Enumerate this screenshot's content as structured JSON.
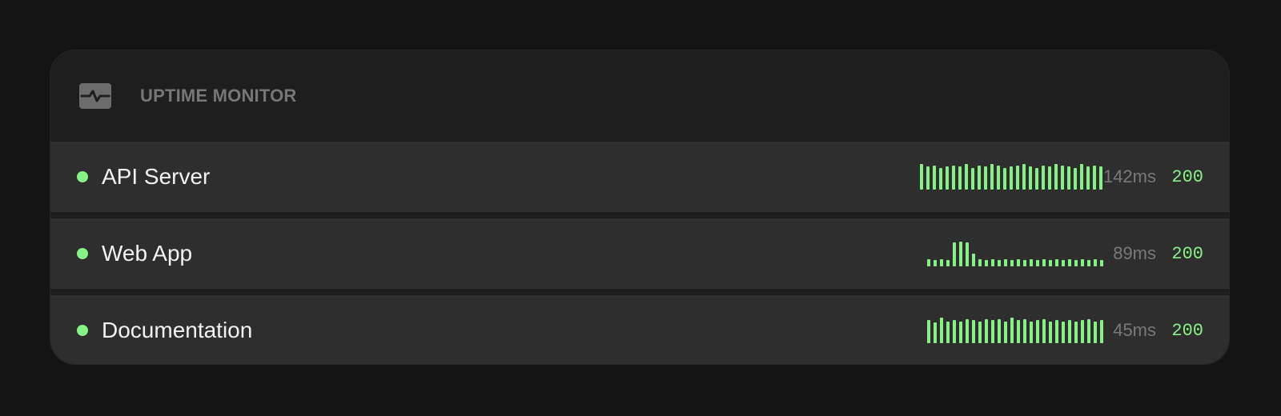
{
  "header": {
    "title": "UPTIME MONITOR",
    "icon": "activity-pulse-icon"
  },
  "colors": {
    "up": "#86f286",
    "degraded": "#f08484",
    "latency_text": "#7a7a7a"
  },
  "services": [
    {
      "name": "API Server",
      "status": "up",
      "latency": "142ms",
      "code": "200",
      "history": {
        "levels": [
          1,
          0.9,
          0.95,
          0.85,
          0.9,
          0.95,
          0.9,
          1,
          0.85,
          0.95,
          0.9,
          1,
          0.95,
          0.85,
          0.9,
          0.95,
          1,
          0.9,
          0.85,
          0.95,
          0.9,
          1,
          0.95,
          0.9,
          0.85,
          1,
          0.9,
          0.95,
          0.9
        ],
        "states": [
          "up",
          "up",
          "up",
          "up",
          "up",
          "up",
          "up",
          "up",
          "up",
          "up",
          "up",
          "up",
          "up",
          "up",
          "up",
          "up",
          "up",
          "up",
          "up",
          "up",
          "up",
          "up",
          "up",
          "up",
          "up",
          "up",
          "up",
          "up",
          "up"
        ]
      }
    },
    {
      "name": "Web App",
      "status": "up",
      "latency": "89ms",
      "code": "200",
      "history": {
        "levels": [
          0.28,
          0.25,
          0.28,
          0.25,
          0.95,
          0.98,
          0.95,
          0.5,
          0.28,
          0.25,
          0.28,
          0.25,
          0.28,
          0.25,
          0.28,
          0.25,
          0.28,
          0.25,
          0.28,
          0.25,
          0.28,
          0.25,
          0.28,
          0.25,
          0.28,
          0.25,
          0.28,
          0.25
        ],
        "states": [
          "up",
          "up",
          "up",
          "up",
          "down",
          "down",
          "up",
          "up",
          "up",
          "up",
          "up",
          "up",
          "up",
          "up",
          "up",
          "up",
          "up",
          "up",
          "up",
          "up",
          "up",
          "up",
          "up",
          "up",
          "up",
          "up",
          "up",
          "up"
        ]
      }
    },
    {
      "name": "Documentation",
      "status": "up",
      "latency": "45ms",
      "code": "200",
      "history": {
        "levels": [
          0.9,
          0.8,
          1,
          0.85,
          0.9,
          0.85,
          0.95,
          0.9,
          0.85,
          0.95,
          0.9,
          0.95,
          0.85,
          1,
          0.9,
          0.95,
          0.85,
          0.9,
          0.95,
          0.85,
          0.9,
          0.85,
          0.9,
          0.85,
          0.9,
          0.95,
          0.85,
          0.9
        ],
        "states": [
          "up",
          "up",
          "up",
          "up",
          "up",
          "up",
          "up",
          "up",
          "up",
          "up",
          "up",
          "up",
          "up",
          "up",
          "up",
          "up",
          "up",
          "up",
          "up",
          "up",
          "up",
          "up",
          "up",
          "up",
          "up",
          "up",
          "up",
          "up"
        ]
      }
    }
  ]
}
